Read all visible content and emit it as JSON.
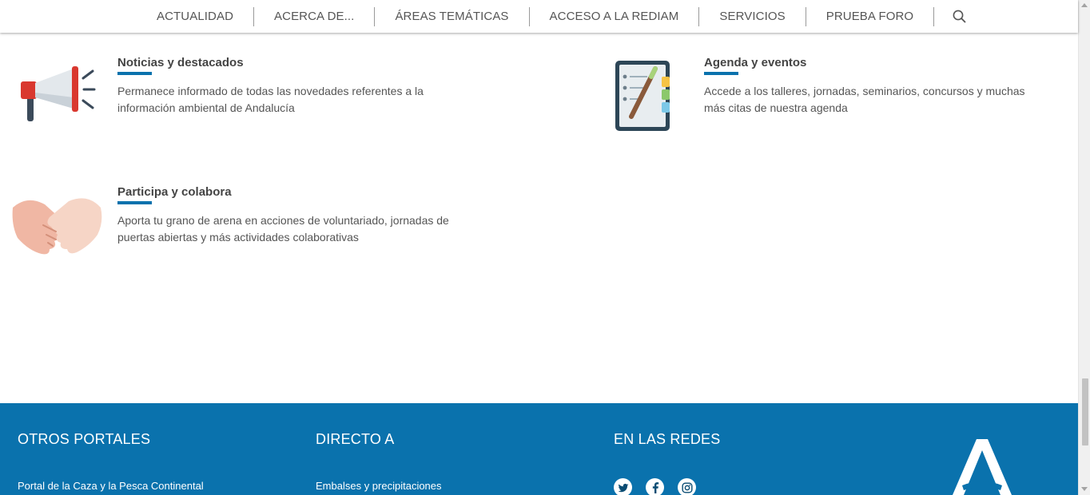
{
  "nav": {
    "items": [
      {
        "label": "ACTUALIDAD"
      },
      {
        "label": "ACERCA DE..."
      },
      {
        "label": "ÁREAS TEMÁTICAS"
      },
      {
        "label": "ACCESO A LA REDIAM"
      },
      {
        "label": "SERVICIOS"
      },
      {
        "label": "PRUEBA FORO"
      }
    ],
    "search_icon": "search-icon"
  },
  "blocks": {
    "noticias": {
      "icon": "megaphone-icon",
      "title": "Noticias y destacados",
      "text": "Permanece informado de todas las novedades referentes a la información ambiental de Andalucía"
    },
    "agenda": {
      "icon": "notebook-icon",
      "title": "Agenda y eventos",
      "text": "Accede a los talleres, jornadas, seminarios, concursos y muchas más citas de nuestra agenda"
    },
    "participa": {
      "icon": "handshake-icon",
      "title": "Participa y colabora",
      "text": "Aporta tu grano de arena en acciones de voluntariado, jornadas de puertas abiertas y más actividades colaborativas"
    }
  },
  "footer": {
    "otros_portales": {
      "heading": "OTROS PORTALES",
      "links": [
        "Portal de la Caza y la Pesca Continental"
      ]
    },
    "directo_a": {
      "heading": "DIRECTO A",
      "links": [
        "Embalses y precipitaciones"
      ]
    },
    "en_las_redes": {
      "heading": "EN LAS REDES",
      "icons": [
        "twitter-icon",
        "facebook-icon",
        "instagram-icon"
      ]
    },
    "logo": "junta-andalucia-logo"
  },
  "colors": {
    "accent": "#0a72ad",
    "footer_bg": "#0a72ad",
    "text": "#555555"
  }
}
